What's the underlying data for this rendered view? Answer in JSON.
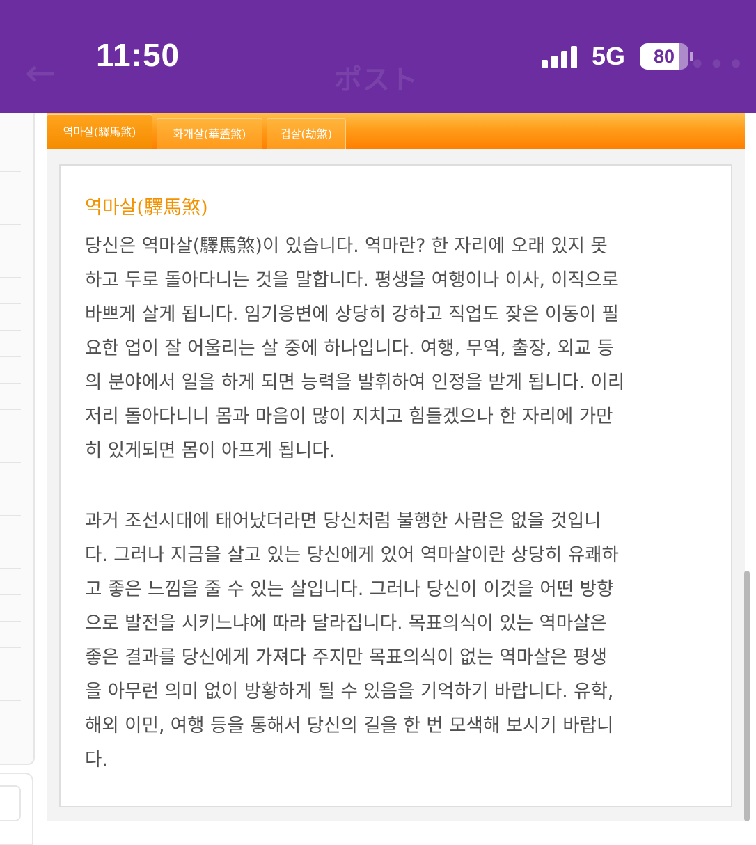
{
  "status_bar": {
    "time": "11:50",
    "network": "5G",
    "battery_percent": 80,
    "battery_label": "80",
    "background_color": "#6b2d9f",
    "signal_icon": "cellular-signal-icon",
    "battery_icon": "battery-icon"
  },
  "nav_underlay": {
    "back_icon": "arrow-left-icon",
    "title": "ポスト",
    "more_icon": "more-dots-icon"
  },
  "tabs": [
    {
      "label": "역마살(驛馬煞)",
      "active": true
    },
    {
      "label": "화개살(華蓋煞)",
      "active": false
    },
    {
      "label": "겁살(劫煞)",
      "active": false
    }
  ],
  "article": {
    "title": "역마살(驛馬煞)",
    "title_color": "#f39200",
    "paragraph1_lines": [
      "당신은 역마살(驛馬煞)이 있습니다. 역마란? 한 자리에 오래 있지 못",
      "하고 두로 돌아다니는 것을 말합니다. 평생을 여행이나 이사, 이직으로",
      "바쁘게 살게 됩니다. 임기응변에 상당히 강하고 직업도 잦은 이동이 필",
      "요한 업이 잘 어울리는 살 중에 하나입니다. 여행, 무역, 출장, 외교 등",
      "의 분야에서 일을 하게 되면 능력을 발휘하여 인정을 받게 됩니다. 이리",
      "저리 돌아다니니 몸과 마음이 많이 지치고 힘들겠으나 한 자리에 가만",
      "히 있게되면 몸이 아프게 됩니다."
    ],
    "paragraph2_lines": [
      "과거 조선시대에 태어났더라면 당신처럼 불행한 사람은 없을 것입니",
      "다. 그러나 지금을 살고 있는 당신에게 있어 역마살이란 상당히 유쾌하",
      "고 좋은 느낌을 줄 수 있는 살입니다. 그러나 당신이 이것을 어떤 방향",
      "으로 발전을 시키느냐에 따라 달라집니다. 목표의식이 있는 역마살은",
      "좋은 결과를 당신에게 가져다 주지만 목표의식이 없는 역마살은 평생",
      "을 아무런 의미 없이 방황하게 될 수 있음을 기억하기 바랍니다. 유학,",
      "해외 이민, 여행 등을 통해서 당신의 길을 한 번 모색해 보시기 바랍니",
      "다."
    ]
  },
  "tab_strip_color": "#ff8c00"
}
